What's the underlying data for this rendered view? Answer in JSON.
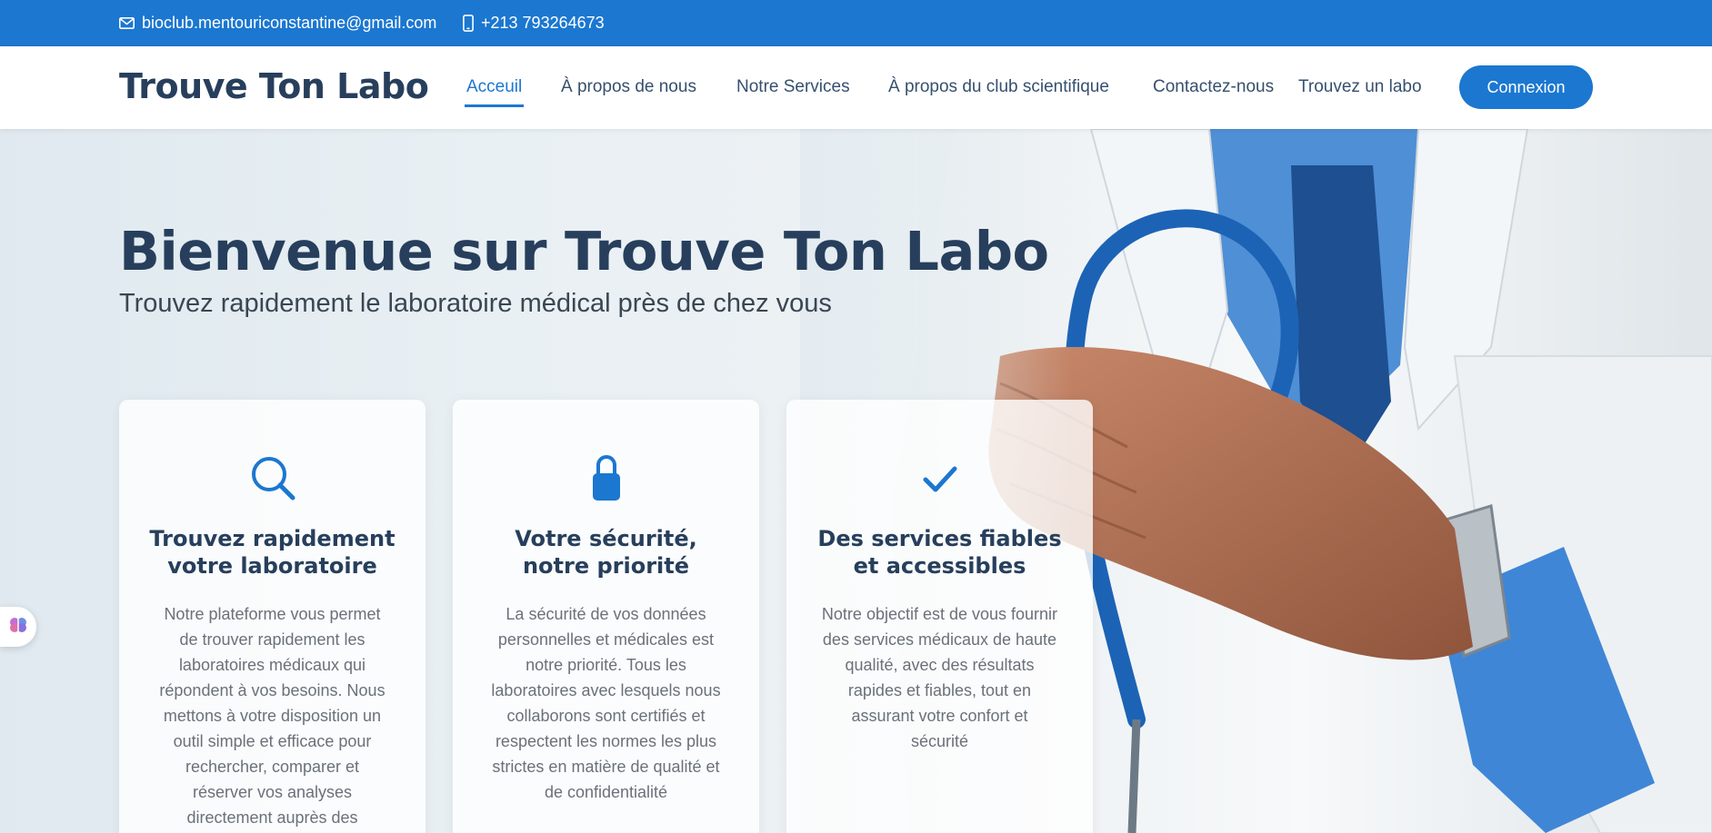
{
  "topbar": {
    "email": "bioclub.mentouriconstantine@gmail.com",
    "phone": "+213 793264673",
    "email_icon": "envelope-icon",
    "phone_icon": "mobile-phone-icon"
  },
  "header": {
    "logo": "Trouve Ton Labo",
    "nav": [
      {
        "label": "Acceuil",
        "active": true
      },
      {
        "label": "À propos de nous"
      },
      {
        "label": "Notre Services"
      },
      {
        "label": "À propos du club scientifique"
      },
      {
        "label": "Contactez-nous"
      },
      {
        "label": "Trouvez un labo"
      }
    ],
    "login_label": "Connexion"
  },
  "hero": {
    "title": "Bienvenue sur Trouve Ton Labo",
    "subtitle": "Trouvez rapidement le laboratoire médical près de chez vous"
  },
  "cards": [
    {
      "icon": "search-icon",
      "title_line1": "Trouvez rapidement",
      "title_line2": "votre laboratoire",
      "text": "Notre plateforme vous permet de trouver rapidement les laboratoires médicaux qui répondent à vos besoins. Nous mettons à votre disposition un outil simple et efficace pour rechercher, comparer et réserver vos analyses directement auprès des"
    },
    {
      "icon": "lock-icon",
      "title_line1": "Votre sécurité,",
      "title_line2": "notre priorité",
      "text": "La sécurité de vos données personnelles et médicales est notre priorité. Tous les laboratoires avec lesquels nous collaborons sont certifiés et respectent les normes les plus strictes en matière de qualité et de confidentialité"
    },
    {
      "icon": "checkmark-icon",
      "title_line1": "Des services fiables",
      "title_line2": "et accessibles",
      "text": "Notre objectif est de vous fournir des services médicaux de haute qualité, avec des résultats rapides et fiables, tout en assurant votre confort et sécurité"
    }
  ],
  "colors": {
    "primary": "#1b77d0",
    "heading": "#273f5c",
    "body_text": "#6a7179"
  },
  "floating_widget": {
    "icon": "brain-icon"
  }
}
